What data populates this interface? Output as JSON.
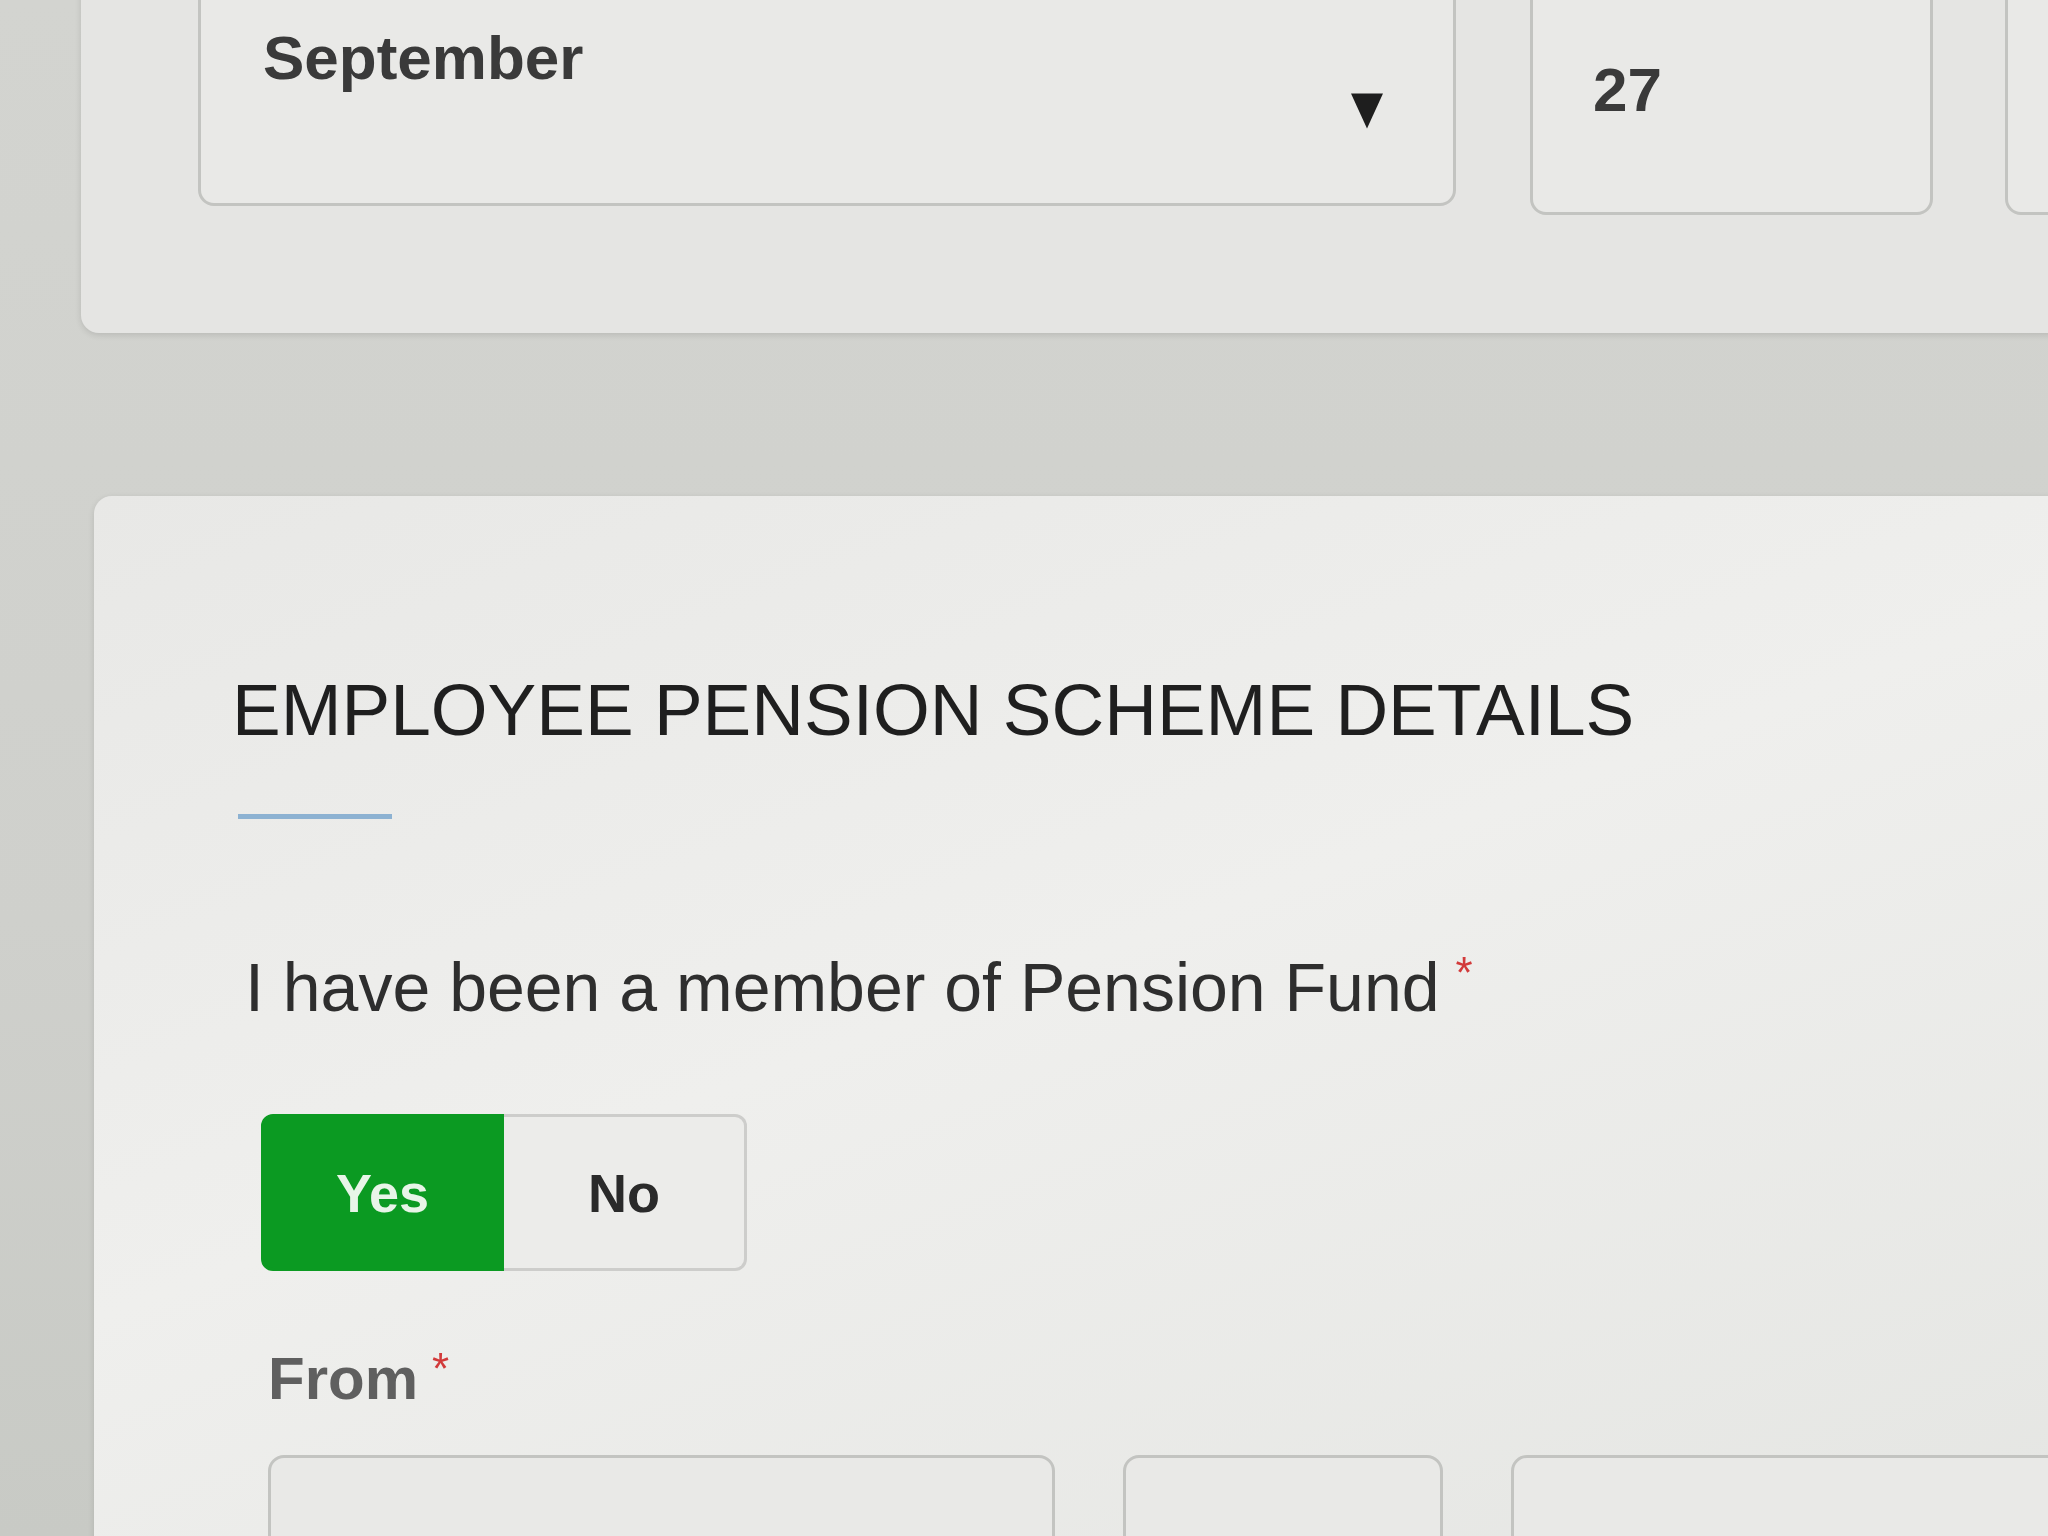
{
  "date_card": {
    "month_select": {
      "value": "September"
    },
    "day_field": {
      "value": "27"
    }
  },
  "pension_section": {
    "title": "EMPLOYEE PENSION SCHEME DETAILS",
    "member_question": {
      "label": "I have been a member of Pension Fund",
      "required_mark": "*",
      "options": [
        {
          "label": "Yes",
          "selected": true
        },
        {
          "label": "No",
          "selected": false
        }
      ]
    },
    "from": {
      "label": "From",
      "required_mark": "*"
    }
  }
}
